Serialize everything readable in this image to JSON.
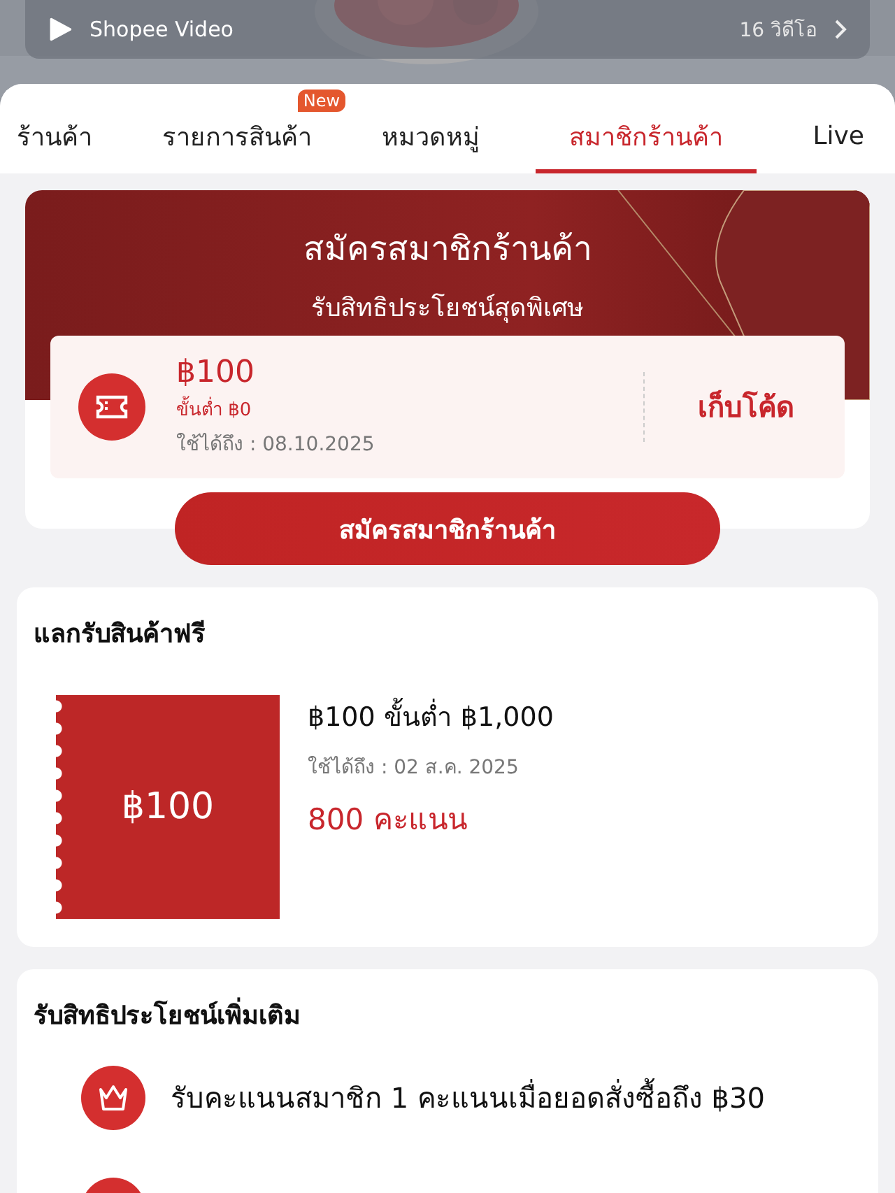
{
  "video_bar": {
    "title": "Shopee Video",
    "count": "16 วิดีโอ"
  },
  "tabs": [
    {
      "label": "ร้านค้า",
      "selected": false
    },
    {
      "label": "รายการสินค้า",
      "selected": false,
      "badge": "New"
    },
    {
      "label": "หมวดหมู่",
      "selected": false
    },
    {
      "label": "สมาชิกร้านค้า",
      "selected": true
    },
    {
      "label": "Live",
      "selected": false
    }
  ],
  "membership": {
    "title": "สมัครสมาชิกร้านค้า",
    "subtitle": "รับสิทธิประโยชน์สุดพิเศษ",
    "voucher": {
      "amount": "฿100",
      "min_spend": "ขั้นต่ำ ฿0",
      "valid_until": "ใช้ได้ถึง : 08.10.2025",
      "action": "เก็บโค้ด"
    },
    "join_button": "สมัครสมาชิกร้านค้า"
  },
  "redeem": {
    "title": "แลกรับสินค้าฟรี",
    "items": [
      {
        "stamp": "฿100",
        "title": "฿100 ขั้นต่ำ ฿1,000",
        "valid_until": "ใช้ได้ถึง : 02 ส.ค. 2025",
        "points": "800",
        "points_unit": "คะแนน"
      }
    ]
  },
  "benefits": {
    "title": "รับสิทธิประโยชน์เพิ่มเติม",
    "items": [
      {
        "kind": "crown",
        "text": "รับคะแนนสมาชิก 1 คะแนนเมื่อยอดสั่งซื้อถึง ฿30"
      }
    ]
  }
}
